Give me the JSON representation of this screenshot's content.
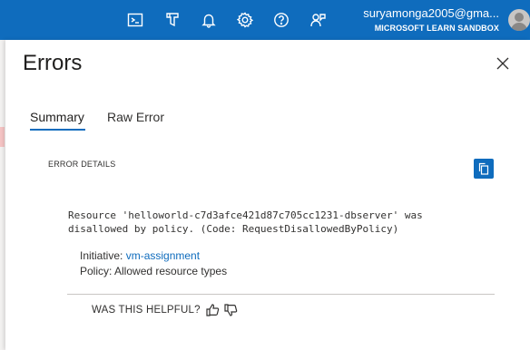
{
  "topbar": {
    "icons": [
      "cloud-shell-icon",
      "directory-filter-icon",
      "notifications-icon",
      "settings-icon",
      "help-icon",
      "feedback-icon"
    ],
    "user": "suryamonga2005@gma...",
    "tenant": "MICROSOFT LEARN SANDBOX",
    "bg_color": "#0f6cbd"
  },
  "blade": {
    "title": "Errors",
    "tabs": [
      {
        "label": "Summary",
        "active": true
      },
      {
        "label": "Raw Error",
        "active": false
      }
    ],
    "section_label": "ERROR DETAILS",
    "message": "Resource 'helloworld-c7d3afce421d87c705cc1231-dbserver' was\ndisallowed by policy. (Code: RequestDisallowedByPolicy)",
    "initiative": {
      "label": "Initiative: ",
      "value": "vm-assignment"
    },
    "policy": {
      "label": "Policy: ",
      "value": "Allowed resource types"
    },
    "helpful": "WAS THIS HELPFUL?"
  }
}
